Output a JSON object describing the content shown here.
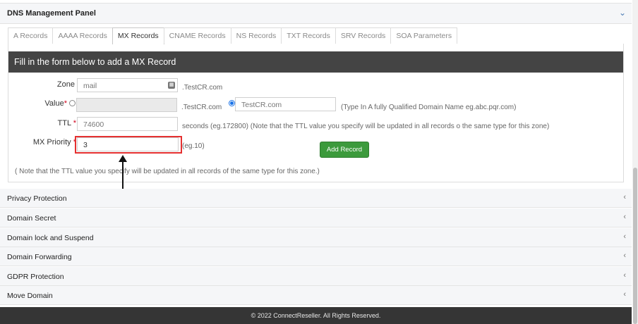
{
  "panel": {
    "title": "DNS Management Panel"
  },
  "tabs": [
    "A Records",
    "AAAA Records",
    "MX Records",
    "CNAME Records",
    "NS Records",
    "TXT Records",
    "SRV Records",
    "SOA Parameters"
  ],
  "active_tab": "MX Records",
  "form": {
    "heading": "Fill in the form below to add a MX Record",
    "zone_label": "Zone",
    "zone_value": "mail",
    "zone_suffix": ".TestCR.com",
    "value_label": "Value",
    "value_suffix": ".TestCR.com",
    "value_domain": "TestCR.com",
    "value_hint": "(Type In A fully Qualified Domain Name eg.abc.pqr.com)",
    "ttl_label": "TTL",
    "ttl_value": "74600",
    "ttl_hint": "seconds (eg.172800) (Note that the TTL value you specify will be updated in all records o the same type for this zone)",
    "priority_label": "MX Priority",
    "priority_value": "3",
    "priority_hint": "(eg.10)",
    "add_button": "Add Record",
    "note": "( Note that the TTL value you specify will be updated in all records of the same type for this zone.)",
    "required_mark": "*"
  },
  "sections": [
    "Privacy Protection",
    "Domain Secret",
    "Domain lock and Suspend",
    "Domain Forwarding",
    "GDPR Protection",
    "Move Domain"
  ],
  "footer": "© 2022 ConnectReseller. All Rights Reserved.",
  "icons": {
    "collapse": "chevron-down-icon",
    "expand": "chevron-left-icon",
    "dropdown": "dropdown-icon"
  },
  "colors": {
    "header_bar": "#444444",
    "button": "#3c9a3c",
    "highlight": "#e53030",
    "required": "#d0021b"
  }
}
